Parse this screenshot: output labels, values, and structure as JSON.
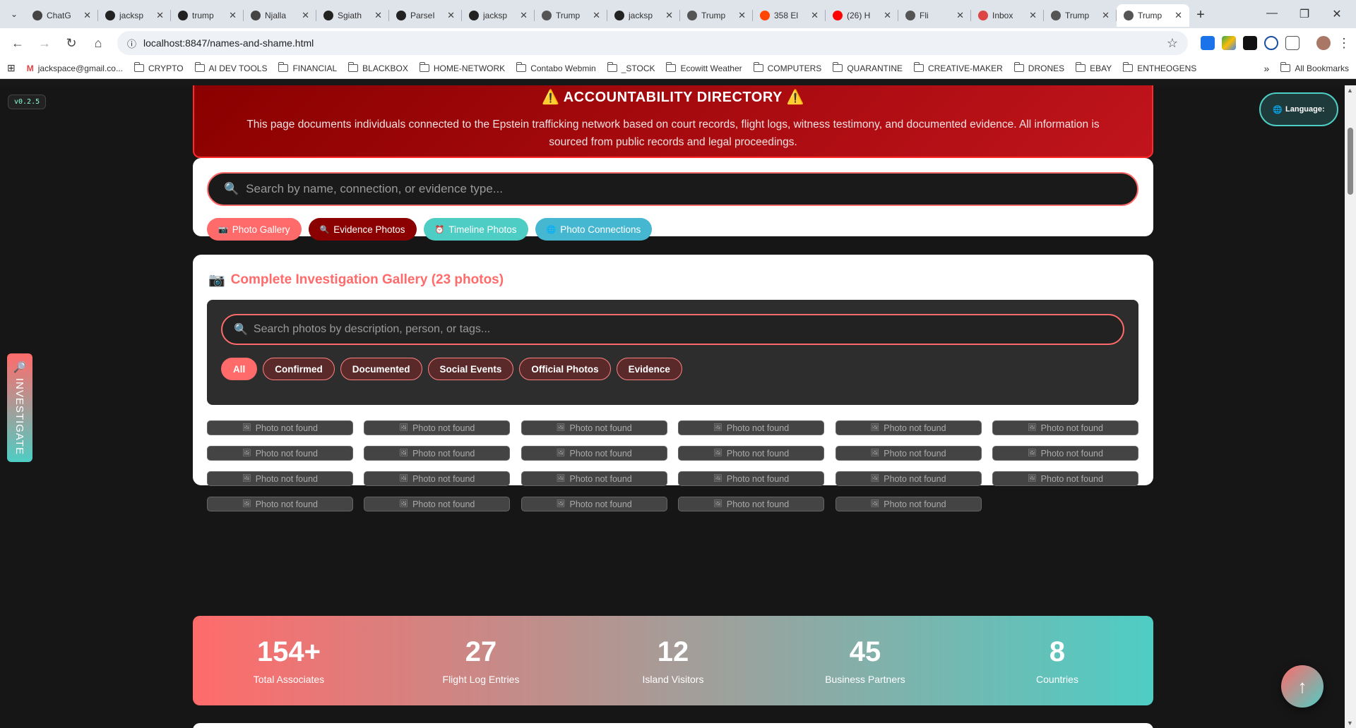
{
  "browser": {
    "tabs": [
      {
        "label": "ChatG",
        "icon": "chatgpt-icon",
        "color": "#444"
      },
      {
        "label": "jacksp",
        "icon": "github-icon",
        "color": "#222"
      },
      {
        "label": "trump",
        "icon": "github-icon",
        "color": "#222"
      },
      {
        "label": "Njalla",
        "icon": "njalla-icon",
        "color": "#444"
      },
      {
        "label": "Sgiath",
        "icon": "github-icon",
        "color": "#222"
      },
      {
        "label": "ParseI",
        "icon": "github-icon",
        "color": "#222"
      },
      {
        "label": "jacksp",
        "icon": "github-icon",
        "color": "#222"
      },
      {
        "label": "Trump",
        "icon": "globe-icon",
        "color": "#555"
      },
      {
        "label": "jacksp",
        "icon": "github-icon",
        "color": "#222"
      },
      {
        "label": "Trump",
        "icon": "globe-icon",
        "color": "#555"
      },
      {
        "label": "358 El",
        "icon": "reddit-icon",
        "color": "#ff4500"
      },
      {
        "label": "(26) H",
        "icon": "youtube-icon",
        "color": "#ff0000"
      },
      {
        "label": "Fli",
        "icon": "globe-icon",
        "color": "#555"
      },
      {
        "label": "Inbox",
        "icon": "gmail-icon",
        "color": "#d44"
      },
      {
        "label": "Trump",
        "icon": "globe-icon",
        "color": "#555"
      },
      {
        "label": "Trump",
        "icon": "globe-icon",
        "color": "#555",
        "active": true
      }
    ],
    "url": "localhost:8847/names-and-shame.html",
    "bookmarks": [
      "jackspace@gmail.co...",
      "CRYPTO",
      "AI DEV TOOLS",
      "FINANCIAL",
      "BLACKBOX",
      "HOME-NETWORK",
      "Contabo Webmin",
      "_STOCK",
      "Ecowitt Weather",
      "COMPUTERS",
      "QUARANTINE",
      "CREATIVE-MAKER",
      "DRONES",
      "EBAY",
      "ENTHEOGENS"
    ],
    "all_bookmarks": "All Bookmarks"
  },
  "page": {
    "version": "v0.2.5",
    "language_label": "Language:",
    "investigate_label": "INVESTIGATE",
    "banner": {
      "title": "ACCOUNTABILITY DIRECTORY",
      "text": "This page documents individuals connected to the Epstein trafficking network based on court records, flight logs, witness testimony, and documented evidence. All information is sourced from public records and legal proceedings."
    },
    "search": {
      "placeholder": "Search by name, connection, or evidence type...",
      "buttons": [
        {
          "label": "Photo Gallery",
          "icon": "📷",
          "color": "#ff6b6b"
        },
        {
          "label": "Evidence Photos",
          "icon": "🔍",
          "color": "#8b0000"
        },
        {
          "label": "Timeline Photos",
          "icon": "⏰",
          "color": "#4ecdc4"
        },
        {
          "label": "Photo Connections",
          "icon": "🌐",
          "color": "#45b7d1"
        }
      ]
    },
    "gallery": {
      "title": "Complete Investigation Gallery (23 photos)",
      "search_placeholder": "Search photos by description, person, or tags...",
      "filters": [
        "All",
        "Confirmed",
        "Documented",
        "Social Events",
        "Official Photos",
        "Evidence"
      ],
      "active_filter": "All",
      "photo_placeholder": "Photo not found",
      "photo_count": 23
    },
    "stats": [
      {
        "value": "154+",
        "label": "Total Associates"
      },
      {
        "value": "27",
        "label": "Flight Log Entries"
      },
      {
        "value": "12",
        "label": "Island Visitors"
      },
      {
        "value": "45",
        "label": "Business Partners"
      },
      {
        "value": "8",
        "label": "Countries"
      }
    ],
    "back_to_top": "↑"
  }
}
